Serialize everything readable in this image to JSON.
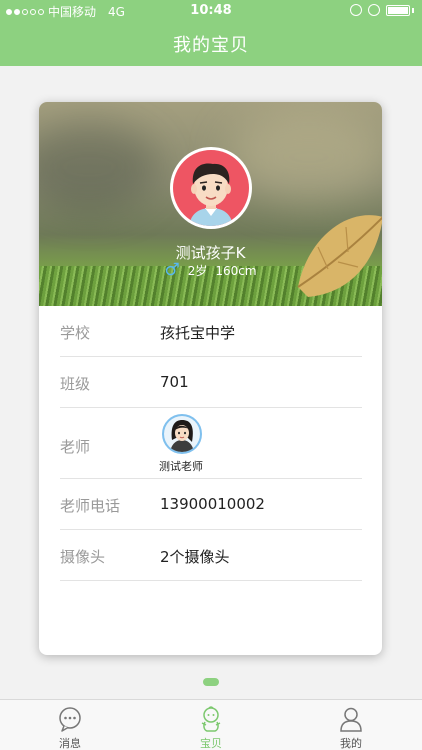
{
  "status_bar": {
    "carrier": "中国移动",
    "network": "4G",
    "time": "10:48"
  },
  "header": {
    "title": "我的宝贝"
  },
  "child": {
    "name": "测试孩子K",
    "gender_icon": "male-symbol-icon",
    "age": "2岁",
    "height": "160cm"
  },
  "info": {
    "school_label": "学校",
    "school_value": "孩托宝中学",
    "class_label": "班级",
    "class_value": "701",
    "teacher_label": "老师",
    "teacher_name": "测试老师",
    "teacher_phone_label": "老师电话",
    "teacher_phone_value": "13900010002",
    "camera_label": "摄像头",
    "camera_value": "2个摄像头"
  },
  "tabs": [
    {
      "label": "消息",
      "icon": "chat-bubble-icon",
      "active": false
    },
    {
      "label": "宝贝",
      "icon": "baby-icon",
      "active": true
    },
    {
      "label": "我的",
      "icon": "person-icon",
      "active": false
    }
  ],
  "colors": {
    "accent": "#8dd180",
    "tab_active": "#7cc86e"
  }
}
